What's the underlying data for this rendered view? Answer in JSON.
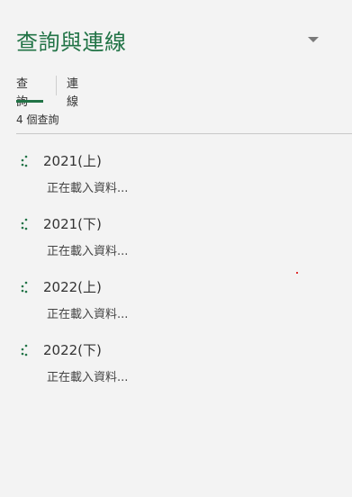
{
  "pane": {
    "title": "查詢與連線",
    "accent_color": "#217346",
    "collapse_icon": "chevron-down-icon"
  },
  "tabs": [
    {
      "label": "查詢",
      "active": true
    },
    {
      "label": "連線",
      "active": false
    }
  ],
  "query_count_label": "4 個查詢",
  "queries": [
    {
      "name": "2021(上)",
      "status": "正在載入資料...",
      "icon": "loading-spinner-icon"
    },
    {
      "name": "2021(下)",
      "status": "正在載入資料...",
      "icon": "loading-spinner-icon"
    },
    {
      "name": "2022(上)",
      "status": "正在載入資料...",
      "icon": "loading-spinner-icon"
    },
    {
      "name": "2022(下)",
      "status": "正在載入資料...",
      "icon": "loading-spinner-icon"
    }
  ]
}
